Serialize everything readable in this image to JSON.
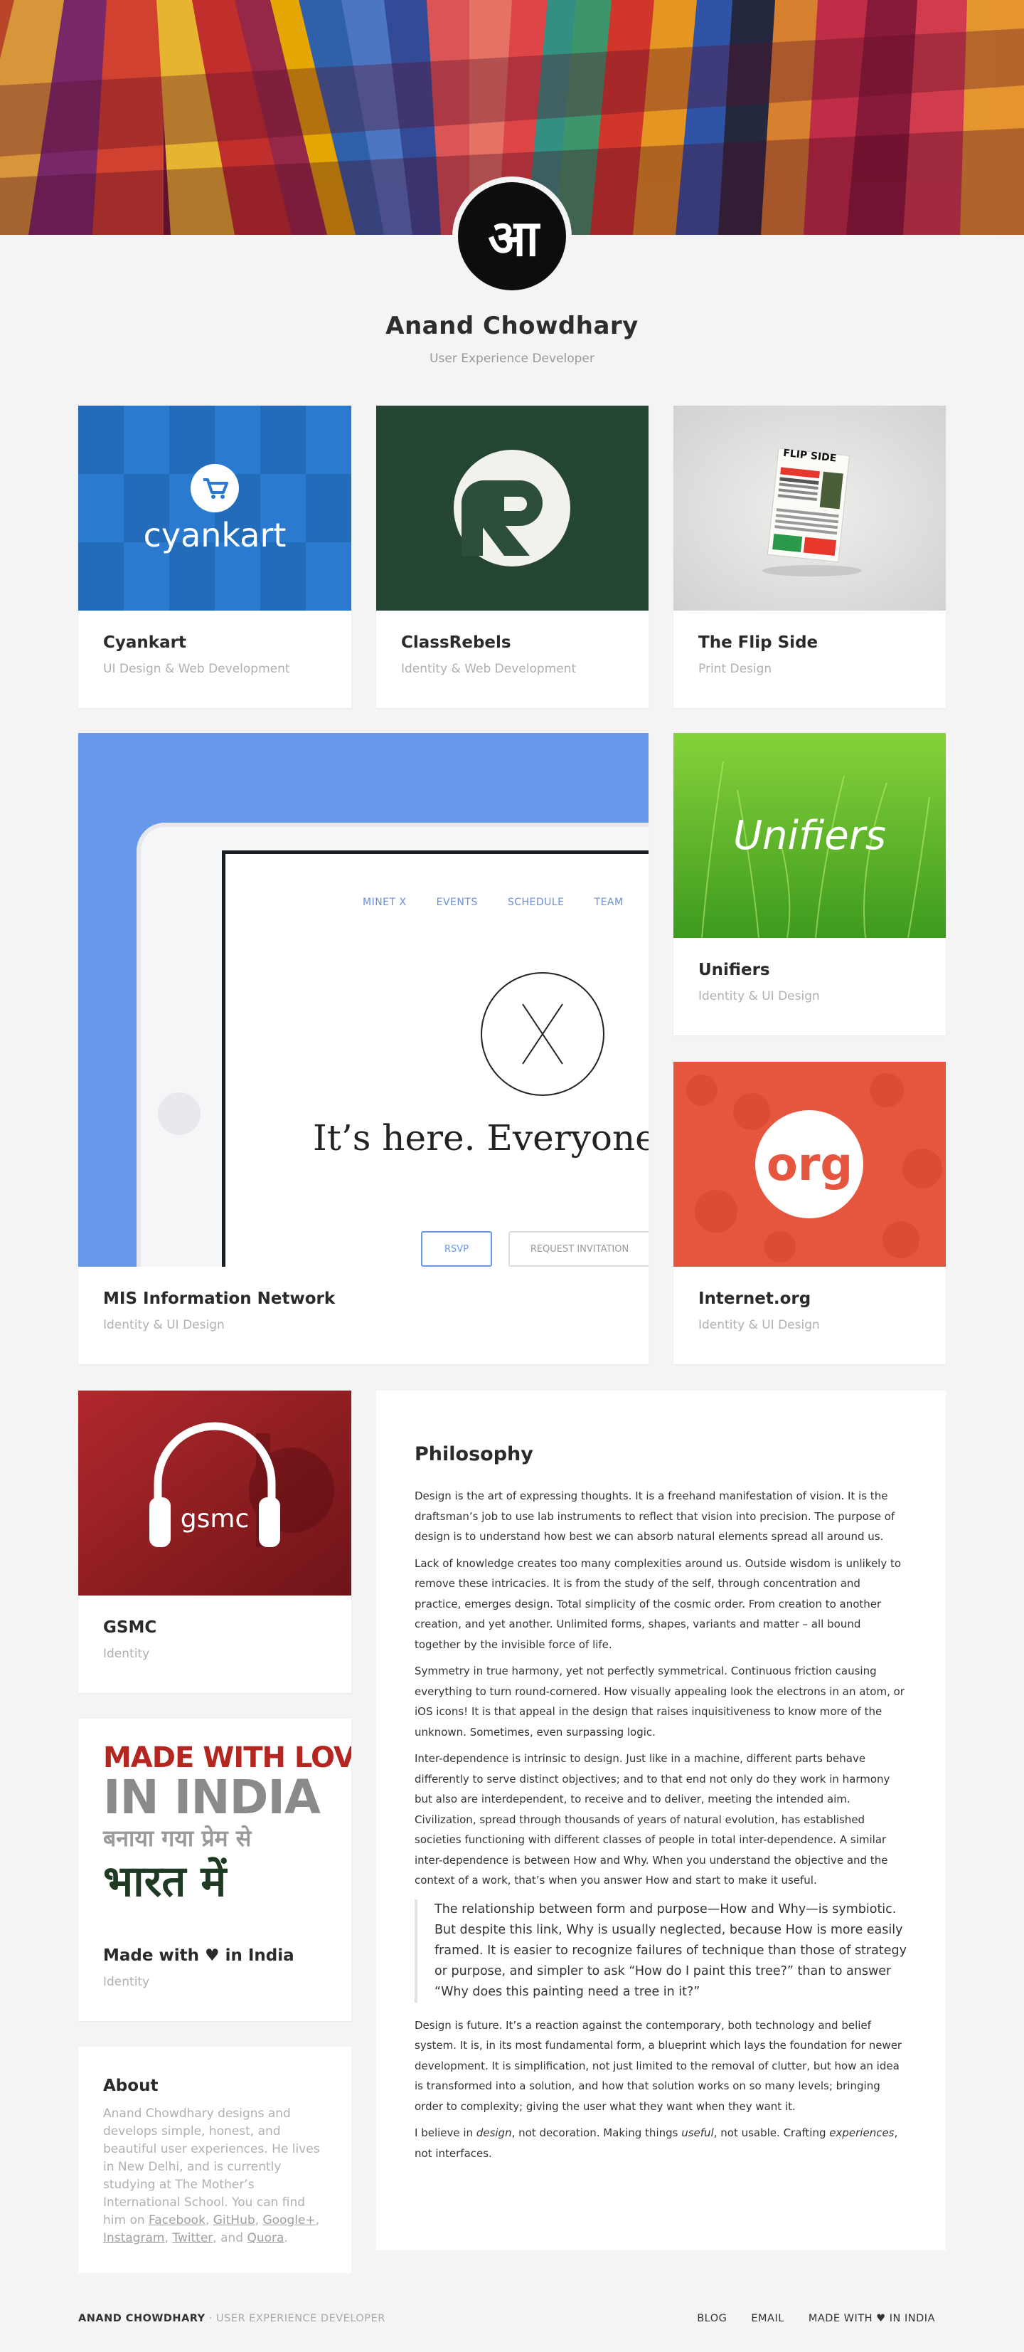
{
  "header": {
    "logo_text": "आ",
    "name": "Anand Chowdhary",
    "subtitle": "User Experience Developer"
  },
  "projects": {
    "cyankart": {
      "title": "Cyankart",
      "category": "UI Design & Web Development",
      "logo_text": "cyankart"
    },
    "classrebels": {
      "title": "ClassRebels",
      "category": "Identity & Web Development"
    },
    "flipside": {
      "title": "The Flip Side",
      "category": "Print Design",
      "logo_text": "FLIP SIDE"
    },
    "mis": {
      "title": "MIS Information Network",
      "category": "Identity & UI Design",
      "nav": [
        "MINET X",
        "EVENTS",
        "SCHEDULE",
        "TEAM"
      ],
      "headline": "It’s here. Everyone’s ta",
      "rsvp": "RSVP",
      "invite": "REQUEST INVITATION"
    },
    "unifiers": {
      "title": "Unifiers",
      "category": "Identity & UI Design",
      "logo_text": "Unifiers"
    },
    "internetorg": {
      "title": "Internet.org",
      "category": "Identity & UI Design",
      "logo_text": "org"
    },
    "gsmc": {
      "title": "GSMC",
      "category": "Identity",
      "logo_text": "gsmc"
    },
    "madeinindia": {
      "title": "Made with ♥ in India",
      "category": "Identity",
      "line1": "MADE WITH LOVE",
      "line2": "IN INDIA",
      "line3": "बनाया गया प्रेम से",
      "line4": "भारत में"
    }
  },
  "philosophy": {
    "heading": "Philosophy",
    "p1": "Design is the art of expressing thoughts. It is a freehand manifestation of vision. It is the draftsman’s job to use lab instruments to reflect that vision into precision. The purpose of design is to understand how best we can absorb natural elements spread all around us.",
    "p2": "Lack of knowledge creates too many complexities around us. Outside wisdom is unlikely to remove these intricacies. It is from the study of the self, through concentration and practice, emerges design. Total simplicity of the cosmic order. From creation to another creation, and yet another. Unlimited forms, shapes, variants and matter – all bound together by the invisible force of life.",
    "p3": "Symmetry in true harmony, yet not perfectly symmetrical. Continuous friction causing everything to turn round-cornered. How visually appealing look the electrons in an atom, or iOS icons! It is that appeal in the design that raises inquisitiveness to know more of the unknown. Sometimes, even surpassing logic.",
    "p4": "Inter-dependence is intrinsic to design. Just like in a machine, different parts behave differently to serve distinct objectives; and to that end not only do they work in harmony but also are interdependent, to receive and to deliver, meeting the intended aim. Civilization, spread through thousands of years of natural evolution, has established societies functioning with different classes of people in total inter-dependence. A similar inter-dependence is between How and Why. When you understand the objective and the context of a work, that’s when you answer How and start to make it useful.",
    "quote": "The relationship between form and purpose—How and Why—is symbiotic. But despite this link, Why is usually neglected, because How is more easily framed. It is easier to recognize failures of technique than those of strategy or purpose, and simpler to ask “How do I paint this tree?” than to answer “Why does this painting need a tree in it?”",
    "p5": "Design is future. It’s a reaction against the contemporary, both technology and belief system. It is, in its most fundamental form, a blueprint which lays the foundation for newer development. It is simplification, not just limited to the removal of clutter, but how an idea is transformed into a solution, and how that solution works on so many levels; bringing order to complexity; giving the user what they want when they want it.",
    "p6_a": "I believe in ",
    "p6_b": "design",
    "p6_c": ", not decoration. Making things ",
    "p6_d": "useful",
    "p6_e": ", not usable. Crafting ",
    "p6_f": "experiences",
    "p6_g": ", not interfaces."
  },
  "about": {
    "heading": "About",
    "text": "Anand Chowdhary designs and develops simple, honest, and beautiful user experiences. He lives in New Delhi, and is currently studying at The Mother’s International School. You can find him on ",
    "links": [
      "Facebook",
      "GitHub",
      "Google+",
      "Instagram",
      "Twitter",
      "Quora"
    ],
    "sep_comma": ", ",
    "sep_and": ", and ",
    "end": "."
  },
  "footer": {
    "name": "ANAND CHOWDHARY",
    "separator": " · ",
    "role": "USER EXPERIENCE DEVELOPER",
    "nav": [
      "BLOG",
      "EMAIL",
      "MADE WITH ♥ IN INDIA"
    ]
  }
}
